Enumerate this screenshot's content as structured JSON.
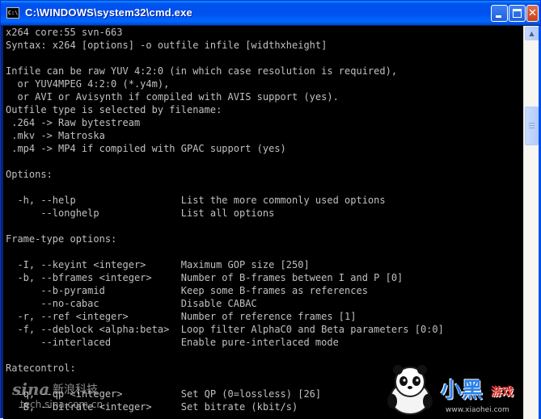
{
  "window": {
    "title": "C:\\WINDOWS\\system32\\cmd.exe",
    "icon": "C:\\"
  },
  "console": {
    "lines": [
      "x264 core:55 svn-663",
      "Syntax: x264 [options] -o outfile infile [widthxheight]",
      "",
      "Infile can be raw YUV 4:2:0 (in which case resolution is required),",
      "  or YUV4MPEG 4:2:0 (*.y4m),",
      "  or AVI or Avisynth if compiled with AVIS support (yes).",
      "Outfile type is selected by filename:",
      " .264 -> Raw bytestream",
      " .mkv -> Matroska",
      " .mp4 -> MP4 if compiled with GPAC support (yes)",
      "",
      "Options:",
      "",
      "  -h, --help                  List the more commonly used options",
      "      --longhelp              List all options",
      "",
      "Frame-type options:",
      "",
      "  -I, --keyint <integer>      Maximum GOP size [250]",
      "  -b, --bframes <integer>     Number of B-frames between I and P [0]",
      "      --b-pyramid             Keep some B-frames as references",
      "      --no-cabac              Disable CABAC",
      "  -r, --ref <integer>         Number of reference frames [1]",
      "  -f, --deblock <alpha:beta>  Loop filter AlphaC0 and Beta parameters [0:0]",
      "      --interlaced            Enable pure-interlaced mode",
      "",
      "Ratecontrol:",
      "",
      "  -q, --qp <integer>          Set QP (0=lossless) [26]",
      "  -B, --bitrate <integer>     Set bitrate (kbit/s)"
    ]
  },
  "watermarks": {
    "left_logo": "sina",
    "left_name": "新浪科技",
    "left_url": "tech.sina.com.cn",
    "right_brand": "小黑",
    "right_sub": "游戏",
    "right_url": "www.xiaohei.com"
  }
}
